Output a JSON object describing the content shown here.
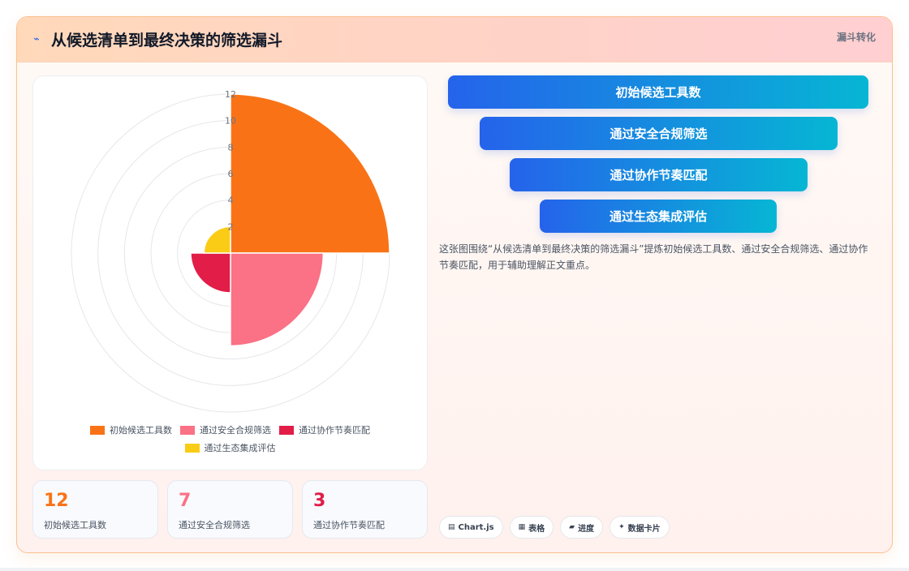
{
  "header": {
    "title": "从候选清单到最终决策的筛选漏斗",
    "tag": "漏斗转化"
  },
  "chart_data": {
    "type": "polarArea",
    "categories": [
      "初始候选工具数",
      "通过安全合规筛选",
      "通过协作节奏匹配",
      "通过生态集成评估"
    ],
    "values": [
      12,
      7,
      3,
      2
    ],
    "colors": [
      "#f97316",
      "#fb7185",
      "#e11d48",
      "#facc15"
    ],
    "r_ticks": [
      "12",
      "10",
      "8",
      "6",
      "4",
      "2"
    ],
    "rlim": [
      0,
      12
    ],
    "legend_position": "bottom"
  },
  "stats": [
    {
      "value": "12",
      "label": "初始候选工具数",
      "color": "#f97316"
    },
    {
      "value": "7",
      "label": "通过安全合规筛选",
      "color": "#fb7185"
    },
    {
      "value": "3",
      "label": "通过协作节奏匹配",
      "color": "#e11d48"
    }
  ],
  "funnel": {
    "stages": [
      "初始候选工具数",
      "通过安全合规筛选",
      "通过协作节奏匹配",
      "通过生态集成评估"
    ]
  },
  "description": "这张图围绕“从候选清单到最终决策的筛选漏斗”提炼初始候选工具数、通过安全合规筛选、通过协作节奏匹配，用于辅助理解正文重点。",
  "chips": [
    {
      "icon": "▤",
      "label": "Chart.js"
    },
    {
      "icon": "▦",
      "label": "表格"
    },
    {
      "icon": "▰",
      "label": "进度"
    },
    {
      "icon": "✦",
      "label": "数据卡片"
    }
  ]
}
